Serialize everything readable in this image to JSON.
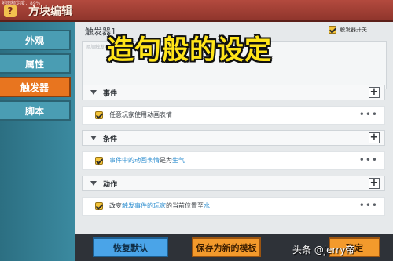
{
  "header": {
    "status_line": "地图额定度：89%",
    "title": "方块编辑"
  },
  "sidebar": {
    "items": [
      {
        "label": "外观"
      },
      {
        "label": "属性"
      },
      {
        "label": "触发器",
        "active": true
      },
      {
        "label": "脚本"
      }
    ]
  },
  "trigger": {
    "name": "触发器1",
    "toggle_label": "触发器开关",
    "description_placeholder": "添加触发器描述"
  },
  "overlay": {
    "banner": "造句般的设定"
  },
  "sections": [
    {
      "title": "事件",
      "row_parts": [
        "任意玩家使用动画表情"
      ]
    },
    {
      "title": "条件",
      "row_parts": [
        "事件中的动画表情",
        "是为",
        "生气"
      ]
    },
    {
      "title": "动作",
      "row_parts": [
        "改变",
        "触发事件的玩家",
        "的当前位置至",
        "水"
      ]
    }
  ],
  "footer": {
    "reset_label": "恢复默认",
    "save_template_label": "保存为新的模板",
    "confirm_label": "确定"
  },
  "watermark": "头条 @jerry帝",
  "colors": {
    "accent_orange": "#e8751f",
    "sidebar_teal": "#3b8aa0",
    "highlight_blue": "#2f8fd0",
    "checkbox_yellow": "#f5c53a",
    "banner_yellow": "#ffe419"
  },
  "icons": {
    "collapse": "triangle-down-icon",
    "add": "plus-icon",
    "more": "more-dots-icon",
    "check": "checkbox-checked-icon"
  }
}
